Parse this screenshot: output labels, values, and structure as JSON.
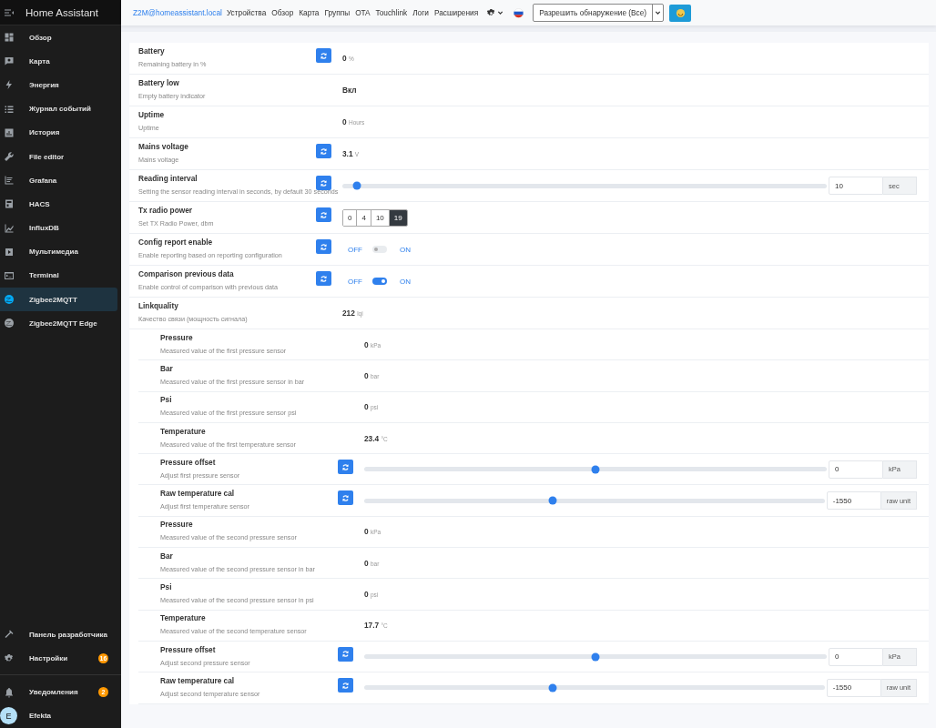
{
  "sidebar": {
    "title": "Home Assistant",
    "items": [
      {
        "label": "Обзор",
        "selected": false
      },
      {
        "label": "Карта",
        "selected": false
      },
      {
        "label": "Энергия",
        "selected": false
      },
      {
        "label": "Журнал событий",
        "selected": false
      },
      {
        "label": "История",
        "selected": false
      },
      {
        "label": "File editor",
        "selected": false
      },
      {
        "label": "Grafana",
        "selected": false
      },
      {
        "label": "HACS",
        "selected": false
      },
      {
        "label": "InfluxDB",
        "selected": false
      },
      {
        "label": "Мультимедиа",
        "selected": false
      },
      {
        "label": "Terminal",
        "selected": false
      },
      {
        "label": "Zigbee2MQTT",
        "selected": true
      },
      {
        "label": "Zigbee2MQTT Edge",
        "selected": false
      }
    ],
    "bottom_items": [
      {
        "label": "Панель разработчика"
      },
      {
        "label": "Настройки",
        "badge": "16"
      }
    ],
    "notifications": {
      "label": "Уведомления",
      "badge": "2"
    },
    "user": {
      "initial": "E",
      "name": "Efekta"
    }
  },
  "header": {
    "brand": "Z2M@homeassistant.local",
    "nav": [
      "Устройства",
      "Обзор",
      "Карта",
      "Группы",
      "OTA",
      "Touchlink",
      "Логи",
      "Расширения"
    ],
    "permit_join": {
      "value": "Разрешить обнаружение (Все)"
    }
  },
  "features": [
    {
      "kind": "reading",
      "title": "Battery",
      "description": "Remaining battery in %",
      "refresh": true,
      "value": "0",
      "unit": "%"
    },
    {
      "kind": "text",
      "title": "Battery low",
      "description": "Empty battery indicator",
      "refresh": false,
      "value": "Вкл"
    },
    {
      "kind": "reading",
      "title": "Uptime",
      "description": "Uptime",
      "refresh": false,
      "value": "0",
      "unit": "Hours"
    },
    {
      "kind": "reading",
      "title": "Mains voltage",
      "description": "Mains voltage",
      "refresh": true,
      "value": "3.1",
      "unit": "V"
    },
    {
      "kind": "slider",
      "title": "Reading interval",
      "description": "Setting the sensor reading interval in seconds, by default 30 seconds",
      "refresh": true,
      "level": 0.03,
      "value": "10",
      "unit": "sec"
    },
    {
      "kind": "buttons",
      "title": "Tx radio power",
      "description": "Set TX Radio Power, dbm",
      "refresh": true,
      "options": [
        {
          "label": "0",
          "selected": false
        },
        {
          "label": "4",
          "selected": false
        },
        {
          "label": "10",
          "selected": false
        },
        {
          "label": "19",
          "selected": true
        }
      ]
    },
    {
      "kind": "toggle",
      "title": "Config report enable",
      "description": "Enable reporting based on reporting configuration",
      "refresh": true,
      "off_label": "OFF",
      "on_label": "ON",
      "on": false
    },
    {
      "kind": "toggle",
      "title": "Comparison previous data",
      "description": "Enable control of comparison with previous data",
      "refresh": true,
      "off_label": "OFF",
      "on_label": "ON",
      "on": true
    },
    {
      "kind": "reading",
      "title": "Linkquality",
      "description": "Качество связи (мощность сигнала)",
      "refresh": false,
      "value": "212",
      "unit": "lqi"
    }
  ],
  "nested_features": [
    {
      "kind": "reading",
      "title": "Pressure",
      "description": "Measured value of the first pressure sensor",
      "refresh": false,
      "value": "0",
      "unit": "kPa"
    },
    {
      "kind": "reading",
      "title": "Bar",
      "description": "Measured value of the first pressure sensor in bar",
      "refresh": false,
      "value": "0",
      "unit": "bar"
    },
    {
      "kind": "reading",
      "title": "Psi",
      "description": "Measured value of the first pressure sensor psi",
      "refresh": false,
      "value": "0",
      "unit": "psi"
    },
    {
      "kind": "reading",
      "title": "Temperature",
      "description": "Measured value of the first temperature sensor",
      "refresh": false,
      "value": "23.4",
      "unit": "°C"
    },
    {
      "kind": "slider",
      "title": "Pressure offset",
      "description": "Adjust first pressure sensor",
      "refresh": true,
      "level": 0.5,
      "value": "0",
      "unit": "kPa"
    },
    {
      "kind": "slider",
      "title": "Raw temperature cal",
      "description": "Adjust first temperature sensor",
      "refresh": true,
      "level": 0.41,
      "value": "-1550",
      "unit": "raw unit"
    },
    {
      "kind": "reading",
      "title": "Pressure",
      "description": "Measured value of the second pressure sensor",
      "refresh": false,
      "value": "0",
      "unit": "kPa"
    },
    {
      "kind": "reading",
      "title": "Bar",
      "description": "Measured value of the second pressure sensor in bar",
      "refresh": false,
      "value": "0",
      "unit": "bar"
    },
    {
      "kind": "reading",
      "title": "Psi",
      "description": "Measured value of the second pressure sensor in psi",
      "refresh": false,
      "value": "0",
      "unit": "psi"
    },
    {
      "kind": "reading",
      "title": "Temperature",
      "description": "Measured value of the second temperature sensor",
      "refresh": false,
      "value": "17.7",
      "unit": "°C"
    },
    {
      "kind": "slider",
      "title": "Pressure offset",
      "description": "Adjust second pressure sensor",
      "refresh": true,
      "level": 0.5,
      "value": "0",
      "unit": "kPa"
    },
    {
      "kind": "slider",
      "title": "Raw temperature cal",
      "description": "Adjust second temperature sensor",
      "refresh": true,
      "level": 0.41,
      "value": "-1550",
      "unit": "raw unit"
    }
  ]
}
